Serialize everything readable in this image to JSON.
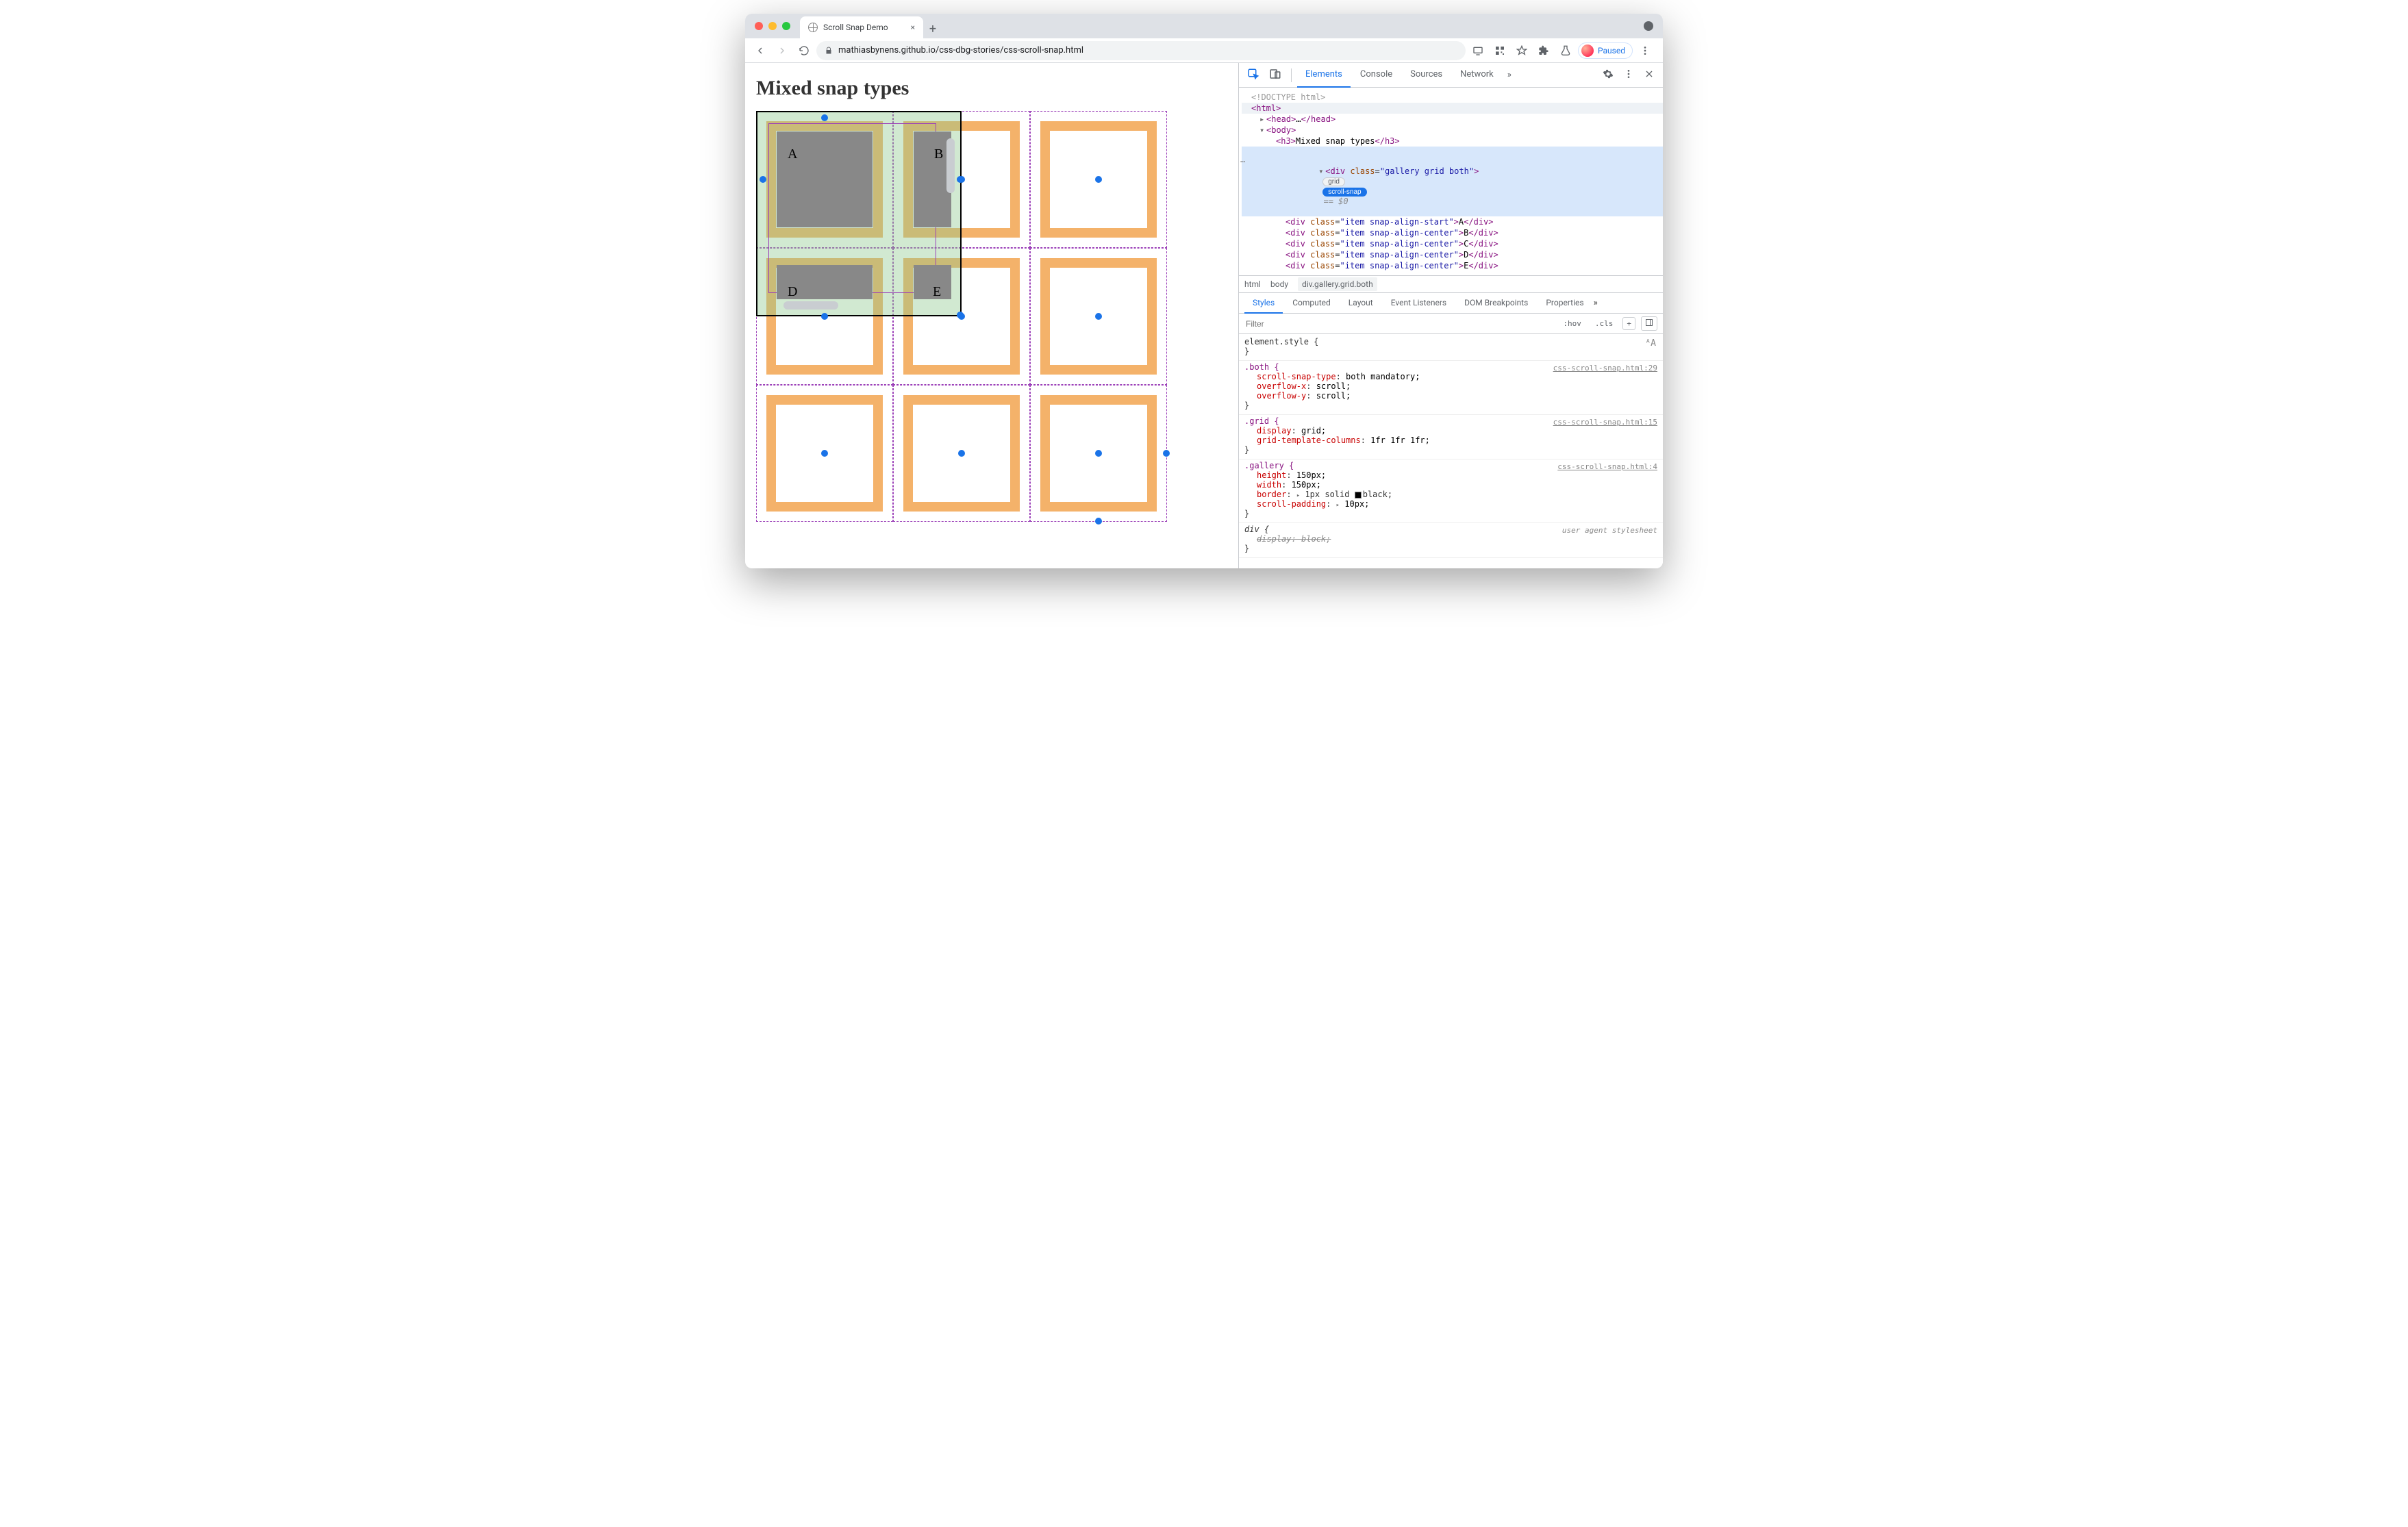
{
  "browser": {
    "tab_title": "Scroll Snap Demo",
    "url_display": "mathiasbynens.github.io/css-dbg-stories/css-scroll-snap.html",
    "new_tab_plus": "+",
    "tab_close": "×",
    "paused_label": "Paused"
  },
  "page": {
    "heading": "Mixed snap types",
    "items": [
      "A",
      "B",
      "D",
      "E"
    ]
  },
  "devtools": {
    "main_tabs": [
      "Elements",
      "Console",
      "Sources",
      "Network"
    ],
    "more": "»",
    "dom": {
      "doctype": "<!DOCTYPE html>",
      "html_open": "<html>",
      "head": {
        "open": "<head>",
        "ell": "…",
        "close": "</head>"
      },
      "body_open": "<body>",
      "h3": {
        "open": "<h3>",
        "text": "Mixed snap types",
        "close": "</h3>"
      },
      "selected": {
        "open_tag": "div",
        "attr_name": "class",
        "attr_val": "gallery grid both",
        "pill_grid": "grid",
        "pill_snap": "scroll-snap",
        "eq": "== $0"
      },
      "children": [
        {
          "tag": "div",
          "cls": "item snap-align-start",
          "txt": "A"
        },
        {
          "tag": "div",
          "cls": "item snap-align-center",
          "txt": "B"
        },
        {
          "tag": "div",
          "cls": "item snap-align-center",
          "txt": "C"
        },
        {
          "tag": "div",
          "cls": "item snap-align-center",
          "txt": "D"
        },
        {
          "tag": "div",
          "cls": "item snap-align-center",
          "txt": "E"
        }
      ]
    },
    "crumbs": [
      "html",
      "body",
      "div.gallery.grid.both"
    ],
    "sub_tabs": [
      "Styles",
      "Computed",
      "Layout",
      "Event Listeners",
      "DOM Breakpoints",
      "Properties"
    ],
    "filter_placeholder": "Filter",
    "filter_btns": {
      "hov": ":hov",
      "cls": ".cls",
      "plus": "+"
    },
    "rules": {
      "element_style": "element.style {",
      "both": {
        "sel": ".both {",
        "src": "css-scroll-snap.html:29",
        "lines": [
          {
            "p": "scroll-snap-type",
            "v": "both mandatory;"
          },
          {
            "p": "overflow-x",
            "v": "scroll;"
          },
          {
            "p": "overflow-y",
            "v": "scroll;"
          }
        ]
      },
      "grid": {
        "sel": ".grid {",
        "src": "css-scroll-snap.html:15",
        "lines": [
          {
            "p": "display",
            "v": "grid;"
          },
          {
            "p": "grid-template-columns",
            "v": "1fr 1fr 1fr;"
          }
        ]
      },
      "gallery": {
        "sel": ".gallery {",
        "src": "css-scroll-snap.html:4",
        "lines": [
          {
            "p": "height",
            "v": "150px;"
          },
          {
            "p": "width",
            "v": "150px;"
          },
          {
            "p": "border",
            "v": "1px solid ■ black;",
            "tri": true,
            "swatch": true
          },
          {
            "p": "scroll-padding",
            "v": "10px;",
            "tri": true
          }
        ]
      },
      "div_ua": {
        "sel": "div {",
        "src": "user agent stylesheet",
        "line": {
          "p": "display",
          "v": "block;"
        }
      },
      "close": "}"
    }
  }
}
